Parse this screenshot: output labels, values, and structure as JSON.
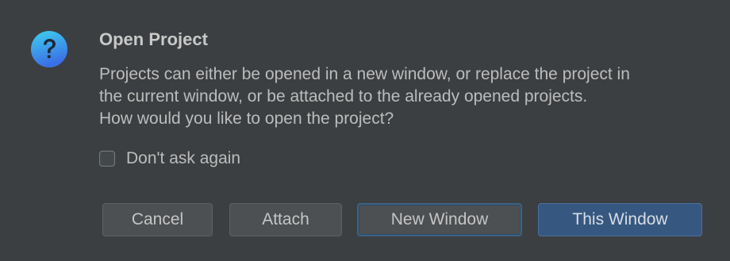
{
  "dialog": {
    "title": "Open Project",
    "icon": "question-icon",
    "message_lines": [
      "Projects can either be opened in a new window, or replace the project in",
      "the current window, or be attached to the already opened projects.",
      "How would you like to open the project?"
    ],
    "dont_ask": {
      "label": "Don't ask again",
      "checked": false
    },
    "buttons": {
      "cancel": "Cancel",
      "attach": "Attach",
      "new_window": "New Window",
      "this_window": "This Window"
    }
  },
  "colors": {
    "background": "#3c3f41",
    "default_button": "#365880",
    "icon_gradient_top": "#3fc8ef",
    "icon_gradient_bottom": "#3a7de8"
  }
}
